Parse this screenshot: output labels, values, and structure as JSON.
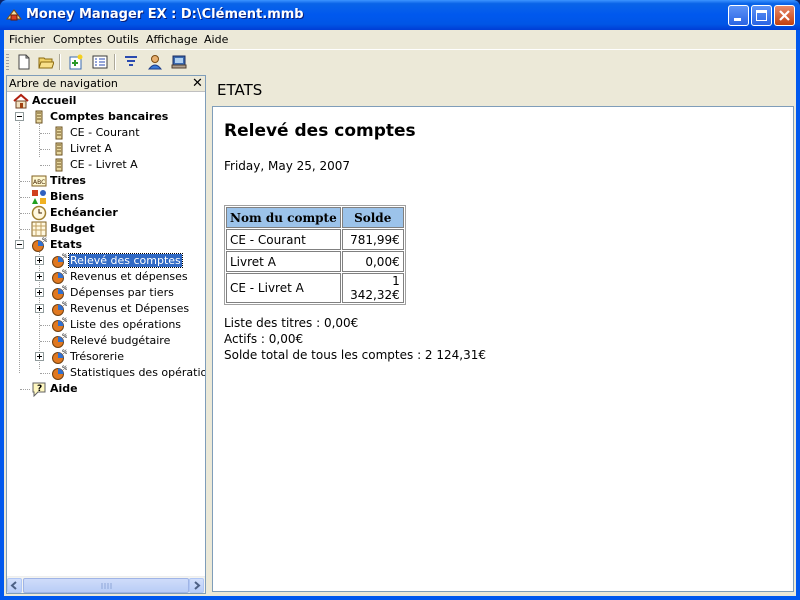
{
  "window": {
    "title": "Money Manager EX : D:\\Clément.mmb",
    "app_icon": "money-manager-icon"
  },
  "menu": [
    "Fichier",
    "Comptes",
    "Outils",
    "Affichage",
    "Aide"
  ],
  "toolbar": {
    "buttons": [
      "new-file-icon",
      "open-folder-icon",
      "new-account-icon",
      "accounts-list-icon",
      "filter-icon",
      "user-icon",
      "report-icon"
    ]
  },
  "nav": {
    "title": "Arbre de navigation",
    "close": "✕",
    "items": {
      "accueil": "Accueil",
      "comptes": "Comptes bancaires",
      "ce_courant": "CE - Courant",
      "livret_a": "Livret A",
      "ce_livret_a": "CE - Livret A",
      "titres": "Titres",
      "biens": "Biens",
      "echeancier": "Echéancier",
      "budget": "Budget",
      "etats": "Etats",
      "releve": "Relevé des comptes",
      "revenus_depenses": "Revenus et dépenses",
      "depenses_tiers": "Dépenses par tiers",
      "revenus_depenses2": "Revenus et Dépenses",
      "liste_operations": "Liste des opérations",
      "releve_budgetaire": "Relevé budgétaire",
      "tresorerie": "Trésorerie",
      "statistiques": "Statistiques des opérations",
      "aide": "Aide"
    },
    "selected": "Relevé des comptes"
  },
  "content": {
    "header": "ETATS",
    "report_title": "Relevé des comptes",
    "date": "Friday, May 25, 2007",
    "table": {
      "headers": [
        "Nom du compte",
        "Solde"
      ],
      "rows": [
        [
          "CE - Courant",
          "781,99€"
        ],
        [
          "Livret A",
          "0,00€"
        ],
        [
          "CE - Livret A",
          "1 342,32€"
        ]
      ]
    },
    "footer": [
      "Liste des titres : 0,00€",
      "Actifs : 0,00€",
      "Solde total de tous les comptes : 2 124,31€"
    ]
  },
  "colors": {
    "title_bar": "#0058ee",
    "selection": "#316ac5",
    "table_header": "#9cc3ea",
    "chrome": "#ece9d8"
  }
}
